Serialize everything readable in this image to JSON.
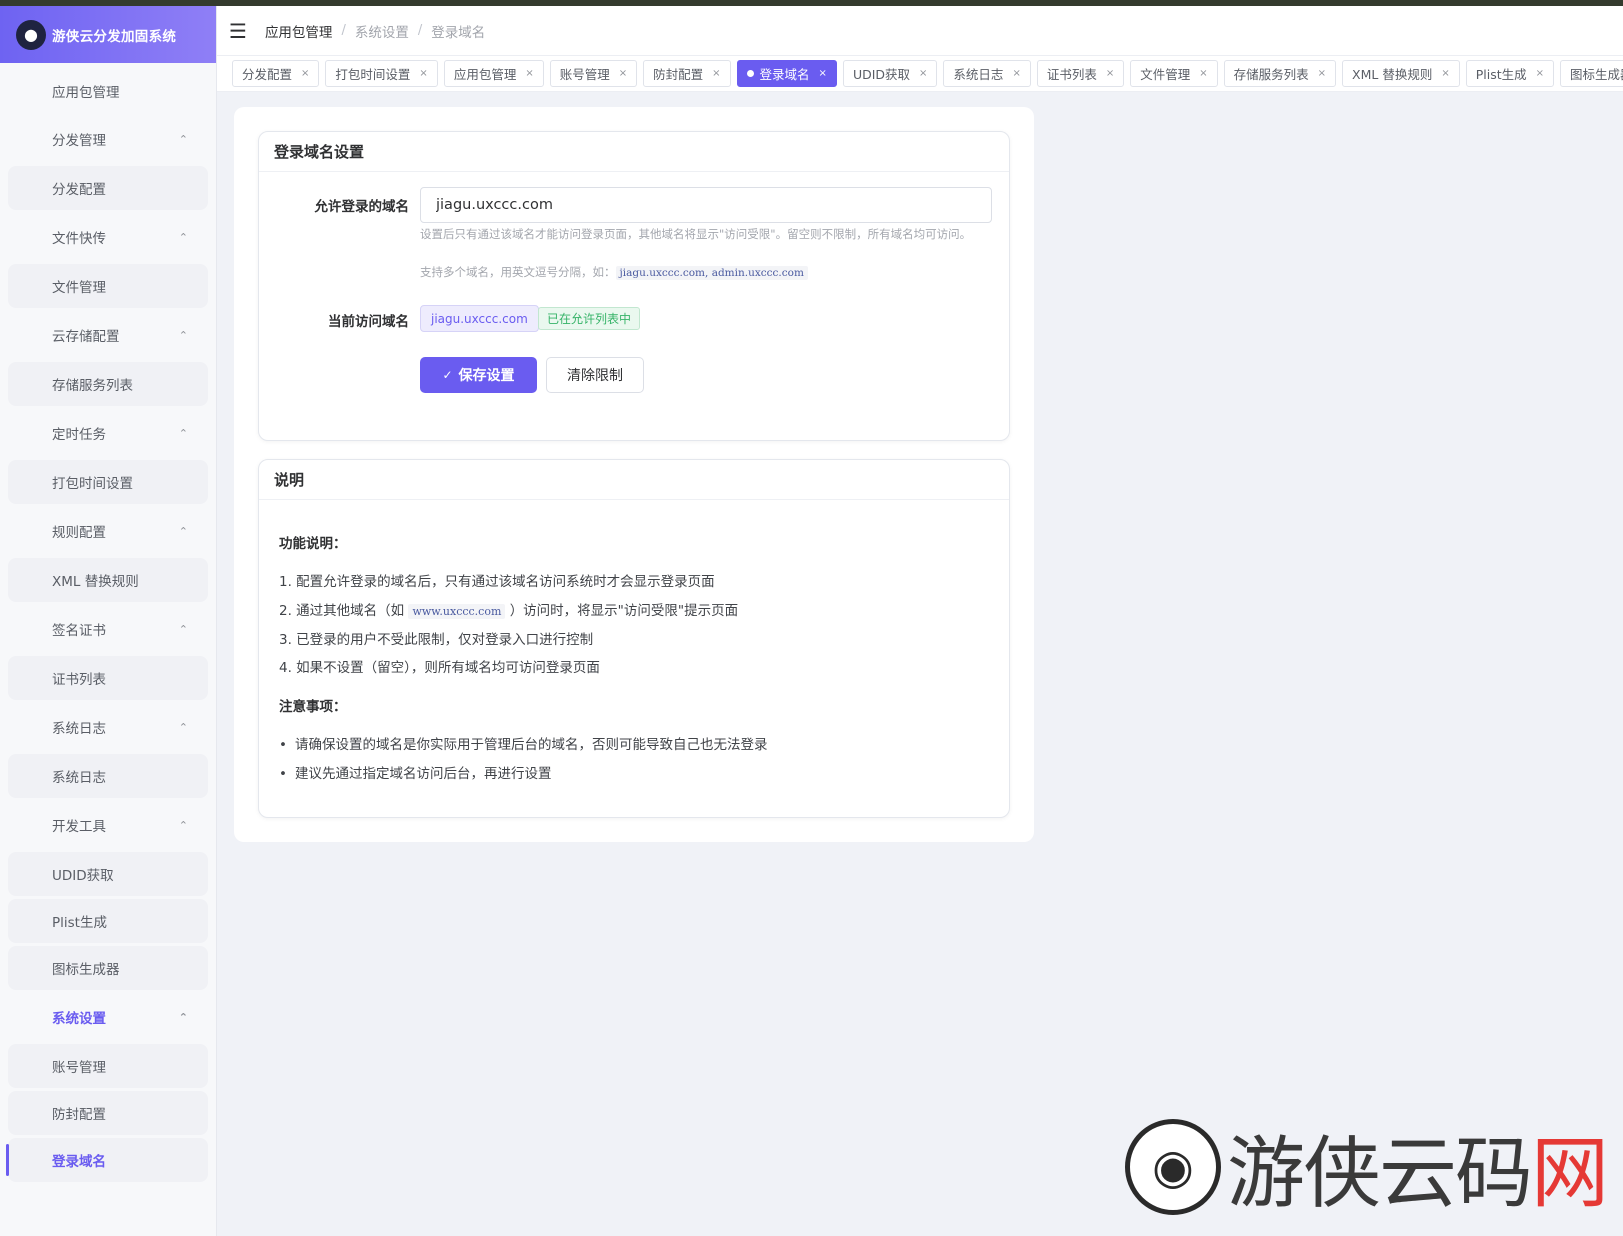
{
  "brand": {
    "title": "游侠云分发加固系统",
    "logo_icon": "hacker-icon",
    "accent": "#6a5cf0"
  },
  "sidebar": {
    "items": [
      {
        "label": "应用包管理",
        "type": "top"
      },
      {
        "label": "分发管理",
        "type": "group"
      },
      {
        "label": "分发配置",
        "type": "sub"
      },
      {
        "label": "文件快传",
        "type": "group"
      },
      {
        "label": "文件管理",
        "type": "sub"
      },
      {
        "label": "云存储配置",
        "type": "group"
      },
      {
        "label": "存储服务列表",
        "type": "sub"
      },
      {
        "label": "定时任务",
        "type": "group"
      },
      {
        "label": "打包时间设置",
        "type": "sub"
      },
      {
        "label": "规则配置",
        "type": "group"
      },
      {
        "label": "XML 替换规则",
        "type": "sub"
      },
      {
        "label": "签名证书",
        "type": "group"
      },
      {
        "label": "证书列表",
        "type": "sub"
      },
      {
        "label": "系统日志",
        "type": "group"
      },
      {
        "label": "系统日志",
        "type": "sub"
      },
      {
        "label": "开发工具",
        "type": "group"
      },
      {
        "label": "UDID获取",
        "type": "sub"
      },
      {
        "label": "Plist生成",
        "type": "sub"
      },
      {
        "label": "图标生成器",
        "type": "sub"
      },
      {
        "label": "系统设置",
        "type": "group",
        "active": true
      },
      {
        "label": "账号管理",
        "type": "sub"
      },
      {
        "label": "防封配置",
        "type": "sub"
      },
      {
        "label": "登录域名",
        "type": "sub",
        "active": true
      }
    ]
  },
  "header": {
    "breadcrumb": [
      "应用包管理",
      "系统设置",
      "登录域名"
    ]
  },
  "tabs": [
    {
      "label": "分发配置"
    },
    {
      "label": "打包时间设置"
    },
    {
      "label": "应用包管理"
    },
    {
      "label": "账号管理"
    },
    {
      "label": "防封配置"
    },
    {
      "label": "登录域名",
      "active": true
    },
    {
      "label": "UDID获取"
    },
    {
      "label": "系统日志"
    },
    {
      "label": "证书列表"
    },
    {
      "label": "文件管理"
    },
    {
      "label": "存储服务列表"
    },
    {
      "label": "XML 替换规则"
    },
    {
      "label": "Plist生成"
    },
    {
      "label": "图标生成器"
    }
  ],
  "settings_card": {
    "title": "登录域名设置",
    "allowed_label": "允许登录的域名",
    "allowed_value": "jiagu.uxccc.com",
    "hint1": "设置后只有通过该域名才能访问登录页面，其他域名将显示\"访问受限\"。留空则不限制，所有域名均可访问。",
    "hint2_prefix": "支持多个域名，用英文逗号分隔，如：",
    "hint2_code": "jiagu.uxccc.com, admin.uxccc.com",
    "current_label": "当前访问域名",
    "current_value": "jiagu.uxccc.com",
    "current_status": "已在允许列表中",
    "save_label": "保存设置",
    "clear_label": "清除限制"
  },
  "info_card": {
    "title": "说明",
    "func_title": "功能说明：",
    "item1": "1. 配置允许登录的域名后，只有通过该域名访问系统时才会显示登录页面",
    "item2_prefix": "2. 通过其他域名（如",
    "item2_code": "www.uxccc.com",
    "item2_suffix": "）访问时，将显示\"访问受限\"提示页面",
    "item3": "3. 已登录的用户不受此限制，仅对登录入口进行控制",
    "item4": "4. 如果不设置（留空），则所有域名均可访问登录页面",
    "caution_title": "注意事项：",
    "caution1": "请确保设置的域名是你实际用于管理后台的域名，否则可能导致自己也无法登录",
    "caution2": "建议先通过指定域名访问后台，再进行设置"
  },
  "watermark": {
    "text": "游侠云码",
    "mark": "网"
  }
}
